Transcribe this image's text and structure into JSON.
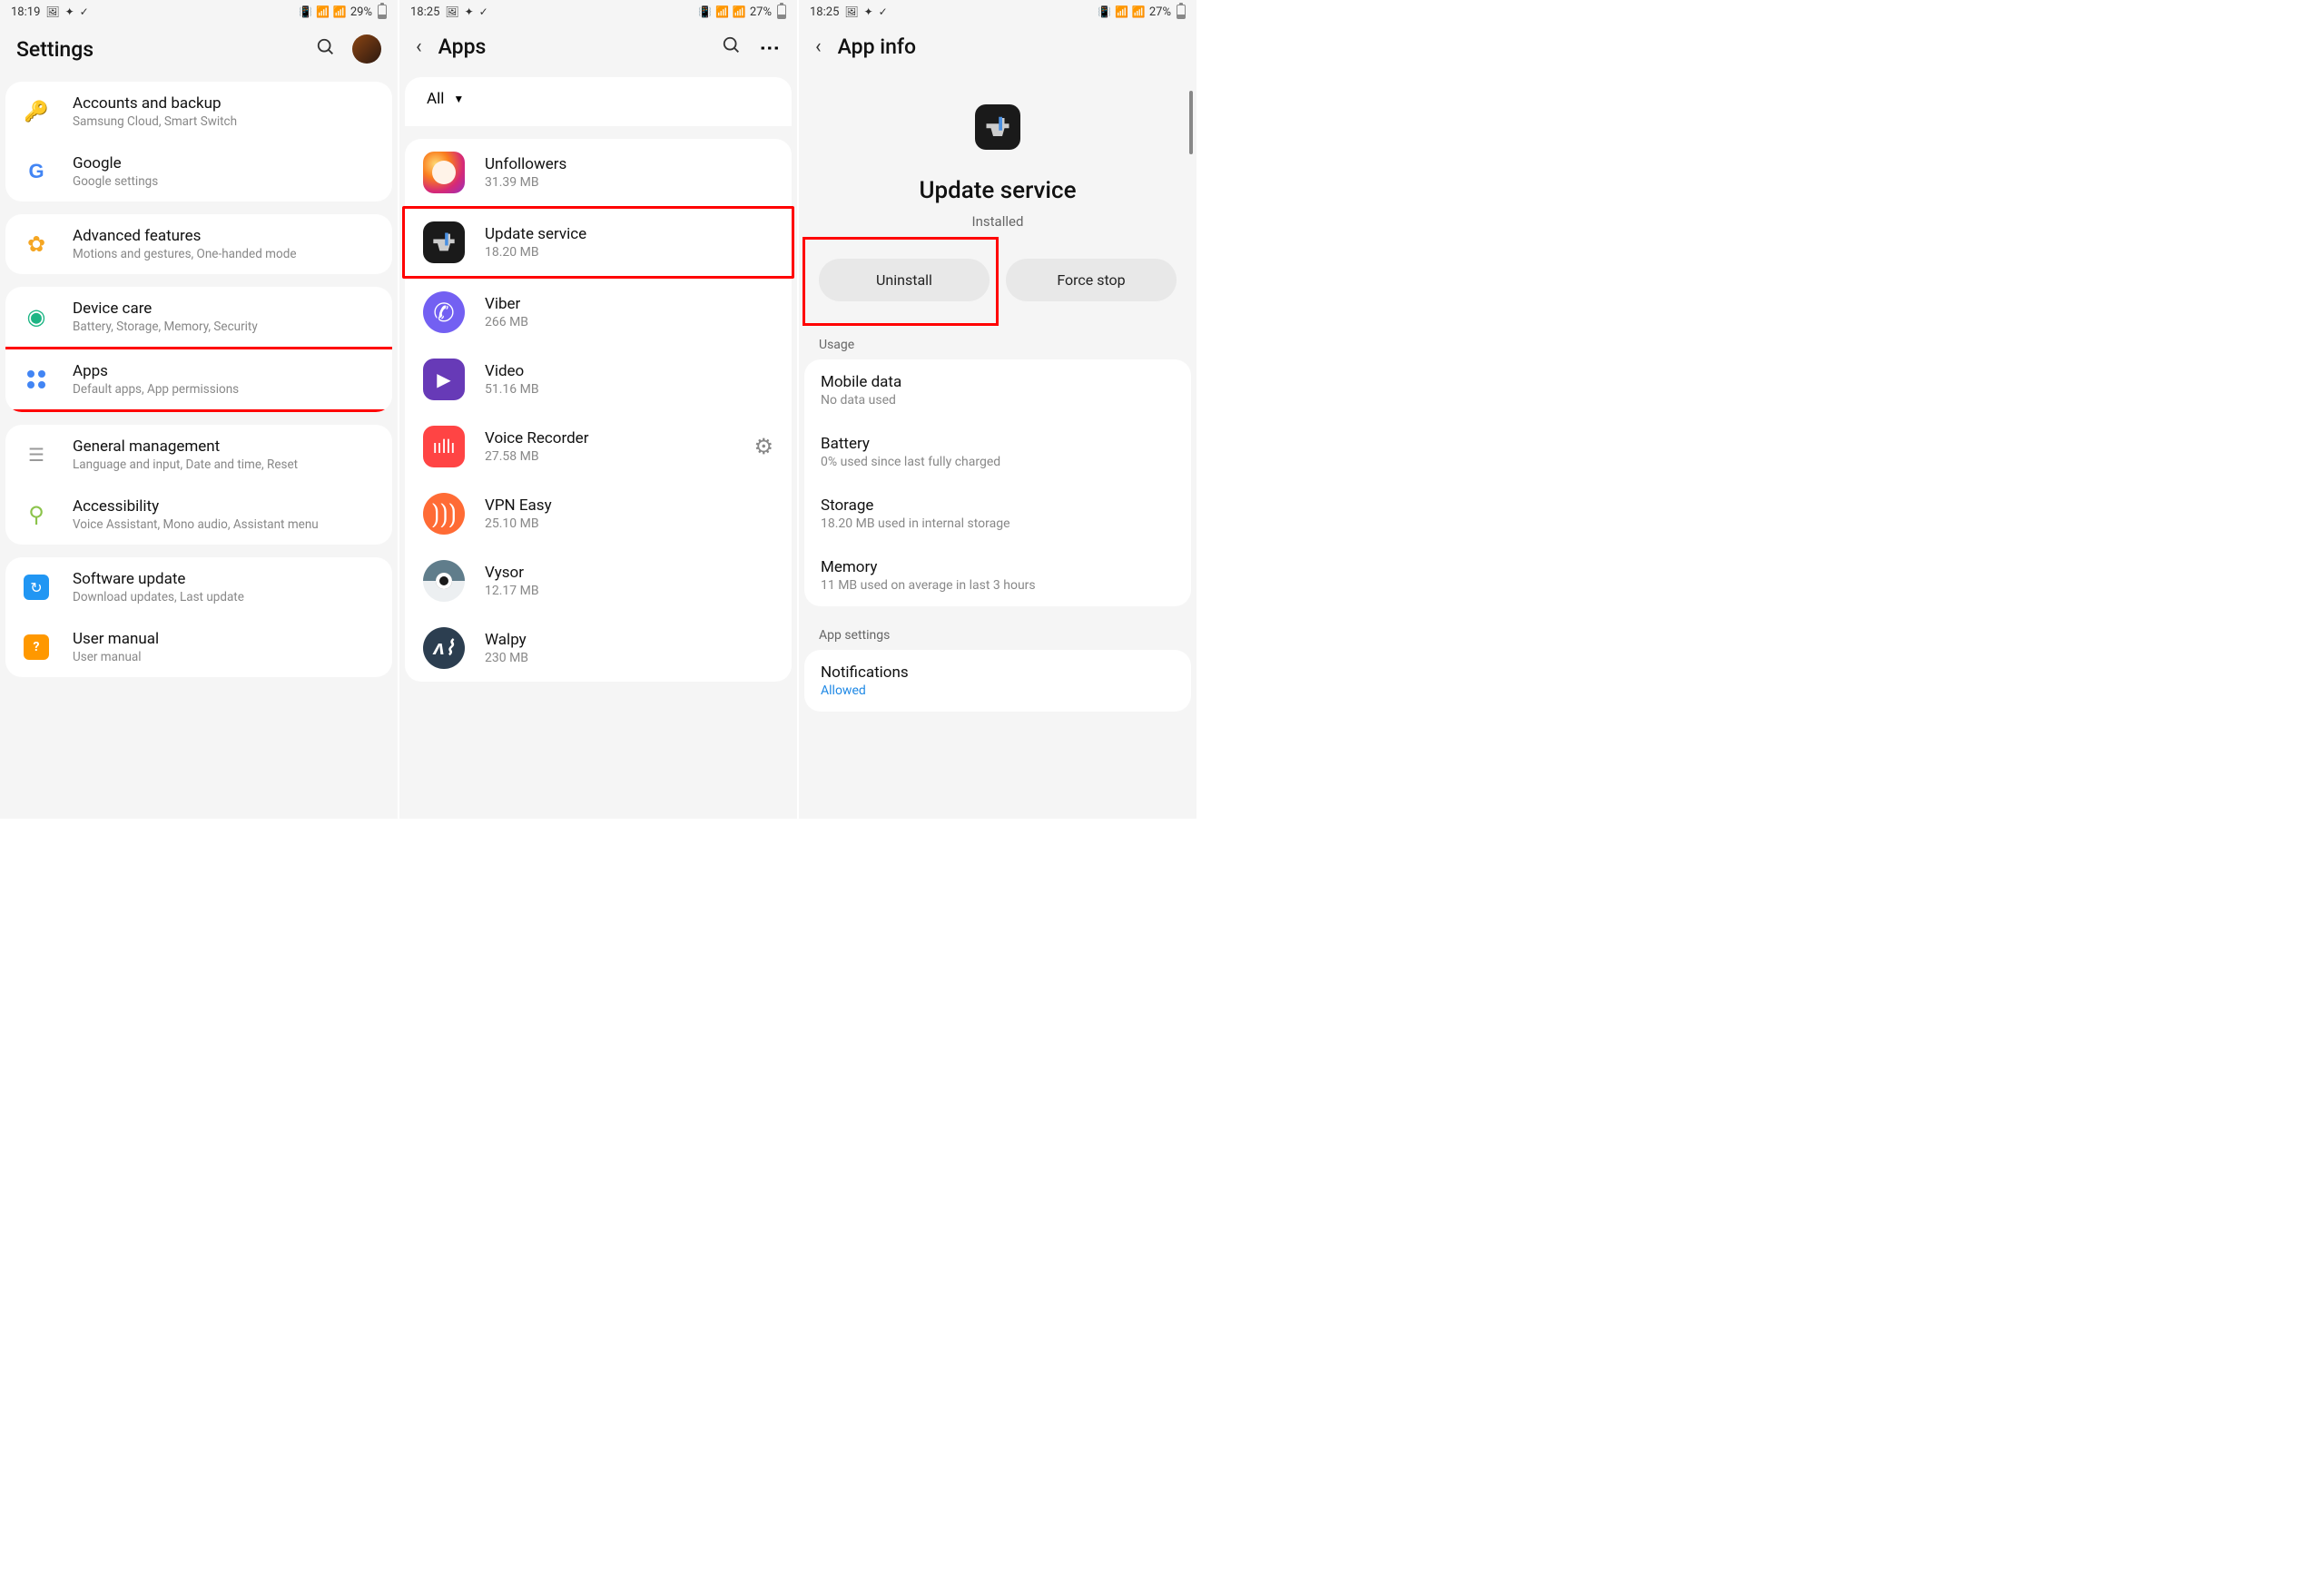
{
  "screen1": {
    "statusbar": {
      "time": "18:19",
      "battery": "29%"
    },
    "header": {
      "title": "Settings"
    },
    "items": [
      {
        "title": "Accounts and backup",
        "subtitle": "Samsung Cloud, Smart Switch"
      },
      {
        "title": "Google",
        "subtitle": "Google settings"
      },
      {
        "title": "Advanced features",
        "subtitle": "Motions and gestures, One-handed mode"
      },
      {
        "title": "Device care",
        "subtitle": "Battery, Storage, Memory, Security"
      },
      {
        "title": "Apps",
        "subtitle": "Default apps, App permissions"
      },
      {
        "title": "General management",
        "subtitle": "Language and input, Date and time, Reset"
      },
      {
        "title": "Accessibility",
        "subtitle": "Voice Assistant, Mono audio, Assistant menu"
      },
      {
        "title": "Software update",
        "subtitle": "Download updates, Last update"
      },
      {
        "title": "User manual",
        "subtitle": "User manual"
      }
    ]
  },
  "screen2": {
    "statusbar": {
      "time": "18:25",
      "battery": "27%"
    },
    "header": {
      "title": "Apps"
    },
    "filter": "All",
    "apps": [
      {
        "name": "Unfollowers",
        "size": "31.39 MB"
      },
      {
        "name": "Update service",
        "size": "18.20 MB"
      },
      {
        "name": "Viber",
        "size": "266 MB"
      },
      {
        "name": "Video",
        "size": "51.16 MB"
      },
      {
        "name": "Voice Recorder",
        "size": "27.58 MB"
      },
      {
        "name": "VPN Easy",
        "size": "25.10 MB"
      },
      {
        "name": "Vysor",
        "size": "12.17 MB"
      },
      {
        "name": "Walpy",
        "size": "230 MB"
      }
    ]
  },
  "screen3": {
    "statusbar": {
      "time": "18:25",
      "battery": "27%"
    },
    "header": {
      "title": "App info"
    },
    "app": {
      "name": "Update service",
      "status": "Installed"
    },
    "actions": {
      "uninstall": "Uninstall",
      "forcestop": "Force stop"
    },
    "usage_label": "Usage",
    "usage": [
      {
        "title": "Mobile data",
        "subtitle": "No data used"
      },
      {
        "title": "Battery",
        "subtitle": "0% used since last fully charged"
      },
      {
        "title": "Storage",
        "subtitle": "18.20 MB used in internal storage"
      },
      {
        "title": "Memory",
        "subtitle": "11 MB used on average in last 3 hours"
      }
    ],
    "appsettings_label": "App settings",
    "notifications": {
      "title": "Notifications",
      "subtitle": "Allowed"
    }
  }
}
